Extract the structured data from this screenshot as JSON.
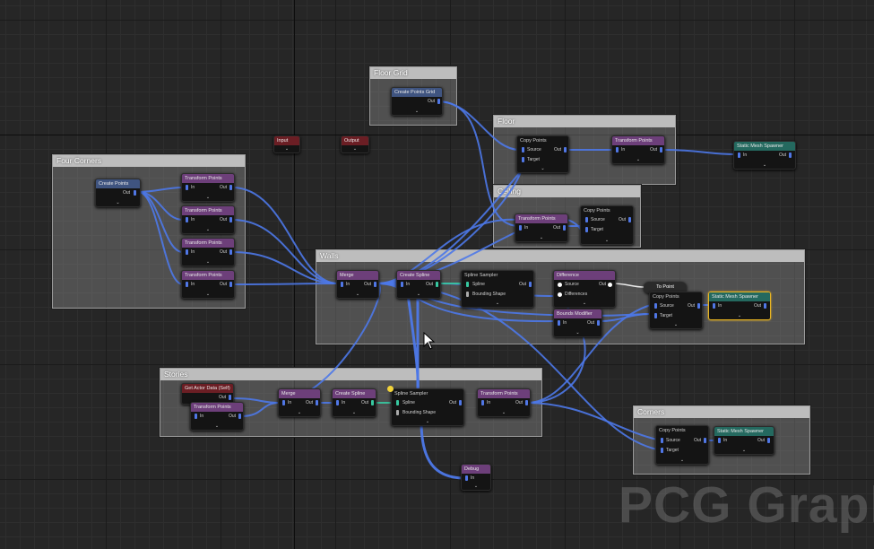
{
  "watermark": "PCG Graph",
  "colors": {
    "wire_point": "#4d78e8",
    "wire_spline": "#37c8a0",
    "header_purple": "#6d3f7a",
    "header_blue": "#3f5480",
    "header_teal": "#24695f",
    "header_red": "#6b1e24",
    "selection": "#e8b422"
  },
  "comments": {
    "floor_grid": "Floor Grid",
    "floor": "Floor",
    "ceiling": "Ceiling",
    "four_corners": "Four Corners",
    "walls": "Walls",
    "stories": "Stories",
    "corners": "Corners"
  },
  "nodes": {
    "floorgrid_create": {
      "title": "Create Points Grid",
      "out": "Out"
    },
    "floor_copy": {
      "title": "Copy Points",
      "source": "Source",
      "target": "Target",
      "out": "Out"
    },
    "floor_transform": {
      "title": "Transform Points",
      "in": "In",
      "out": "Out"
    },
    "floor_mesh": {
      "title": "Static Mesh Spawner",
      "in": "In",
      "out": "Out"
    },
    "input": {
      "title": "Input"
    },
    "output": {
      "title": "Output"
    },
    "corners_create": {
      "title": "Create Points",
      "out": "Out"
    },
    "tp1": {
      "title": "Transform Points",
      "in": "In",
      "out": "Out"
    },
    "tp2": {
      "title": "Transform Points",
      "in": "In",
      "out": "Out"
    },
    "tp3": {
      "title": "Transform Points",
      "in": "In",
      "out": "Out"
    },
    "tp4": {
      "title": "Transform Points",
      "in": "In",
      "out": "Out"
    },
    "ceiling_transform": {
      "title": "Transform Points",
      "in": "In",
      "out": "Out"
    },
    "ceiling_copy": {
      "title": "Copy Points",
      "source": "Source",
      "target": "Target",
      "out": "Out"
    },
    "walls_merge": {
      "title": "Merge",
      "in": "In",
      "out": "Out"
    },
    "walls_spline": {
      "title": "Create Spline",
      "in": "In",
      "out": "Out"
    },
    "walls_sampler": {
      "title": "Spline Sampler",
      "spline": "Spline",
      "bounding": "Bounding Shape",
      "out": "Out"
    },
    "walls_difference": {
      "title": "Difference",
      "source": "Source",
      "differences": "Differences",
      "out": "Out"
    },
    "walls_bounds": {
      "title": "Bounds Modifier",
      "in": "In",
      "out": "Out"
    },
    "walls_topoint": {
      "title": "To Point"
    },
    "walls_copy": {
      "title": "Copy Points",
      "source": "Source",
      "target": "Target",
      "out": "Out"
    },
    "walls_mesh": {
      "title": "Static Mesh Spawner",
      "in": "In",
      "out": "Out"
    },
    "stories_getactor": {
      "title": "Get Actor Data (Self)",
      "out": "Out"
    },
    "stories_transform": {
      "title": "Transform Points",
      "in": "In",
      "out": "Out"
    },
    "stories_merge": {
      "title": "Merge",
      "in": "In",
      "out": "Out"
    },
    "stories_spline": {
      "title": "Create Spline",
      "in": "In",
      "out": "Out"
    },
    "stories_sampler": {
      "title": "Spline Sampler",
      "spline": "Spline",
      "bounding": "Bounding Shape",
      "out": "Out"
    },
    "stories_transform2": {
      "title": "Transform Points",
      "in": "In",
      "out": "Out"
    },
    "debug": {
      "title": "Debug",
      "in": "In"
    },
    "corners_copy": {
      "title": "Copy Points",
      "source": "Source",
      "target": "Target",
      "out": "Out"
    },
    "corners_mesh": {
      "title": "Static Mesh Spawner",
      "in": "In",
      "out": "Out"
    }
  }
}
